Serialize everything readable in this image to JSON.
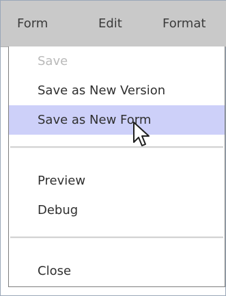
{
  "menubar": {
    "items": [
      {
        "label": "Form"
      },
      {
        "label": "Edit"
      },
      {
        "label": "Format"
      }
    ]
  },
  "menu": {
    "items": [
      {
        "label": "Save",
        "state": "disabled"
      },
      {
        "label": "Save as New Version",
        "state": "normal"
      },
      {
        "label": "Save as New Form",
        "state": "highlighted"
      },
      {
        "label": "Preview",
        "state": "normal"
      },
      {
        "label": "Debug",
        "state": "normal"
      },
      {
        "label": "Close",
        "state": "normal"
      }
    ]
  },
  "icons": {
    "cursor": "mouse-pointer-icon"
  },
  "colors": {
    "menubar_bg": "#c9c9c9",
    "highlight_bg": "#cdd0f9",
    "disabled_text": "#b9b9b9",
    "normal_text": "#2f2f2f",
    "frame_border": "#9aa7b8"
  }
}
